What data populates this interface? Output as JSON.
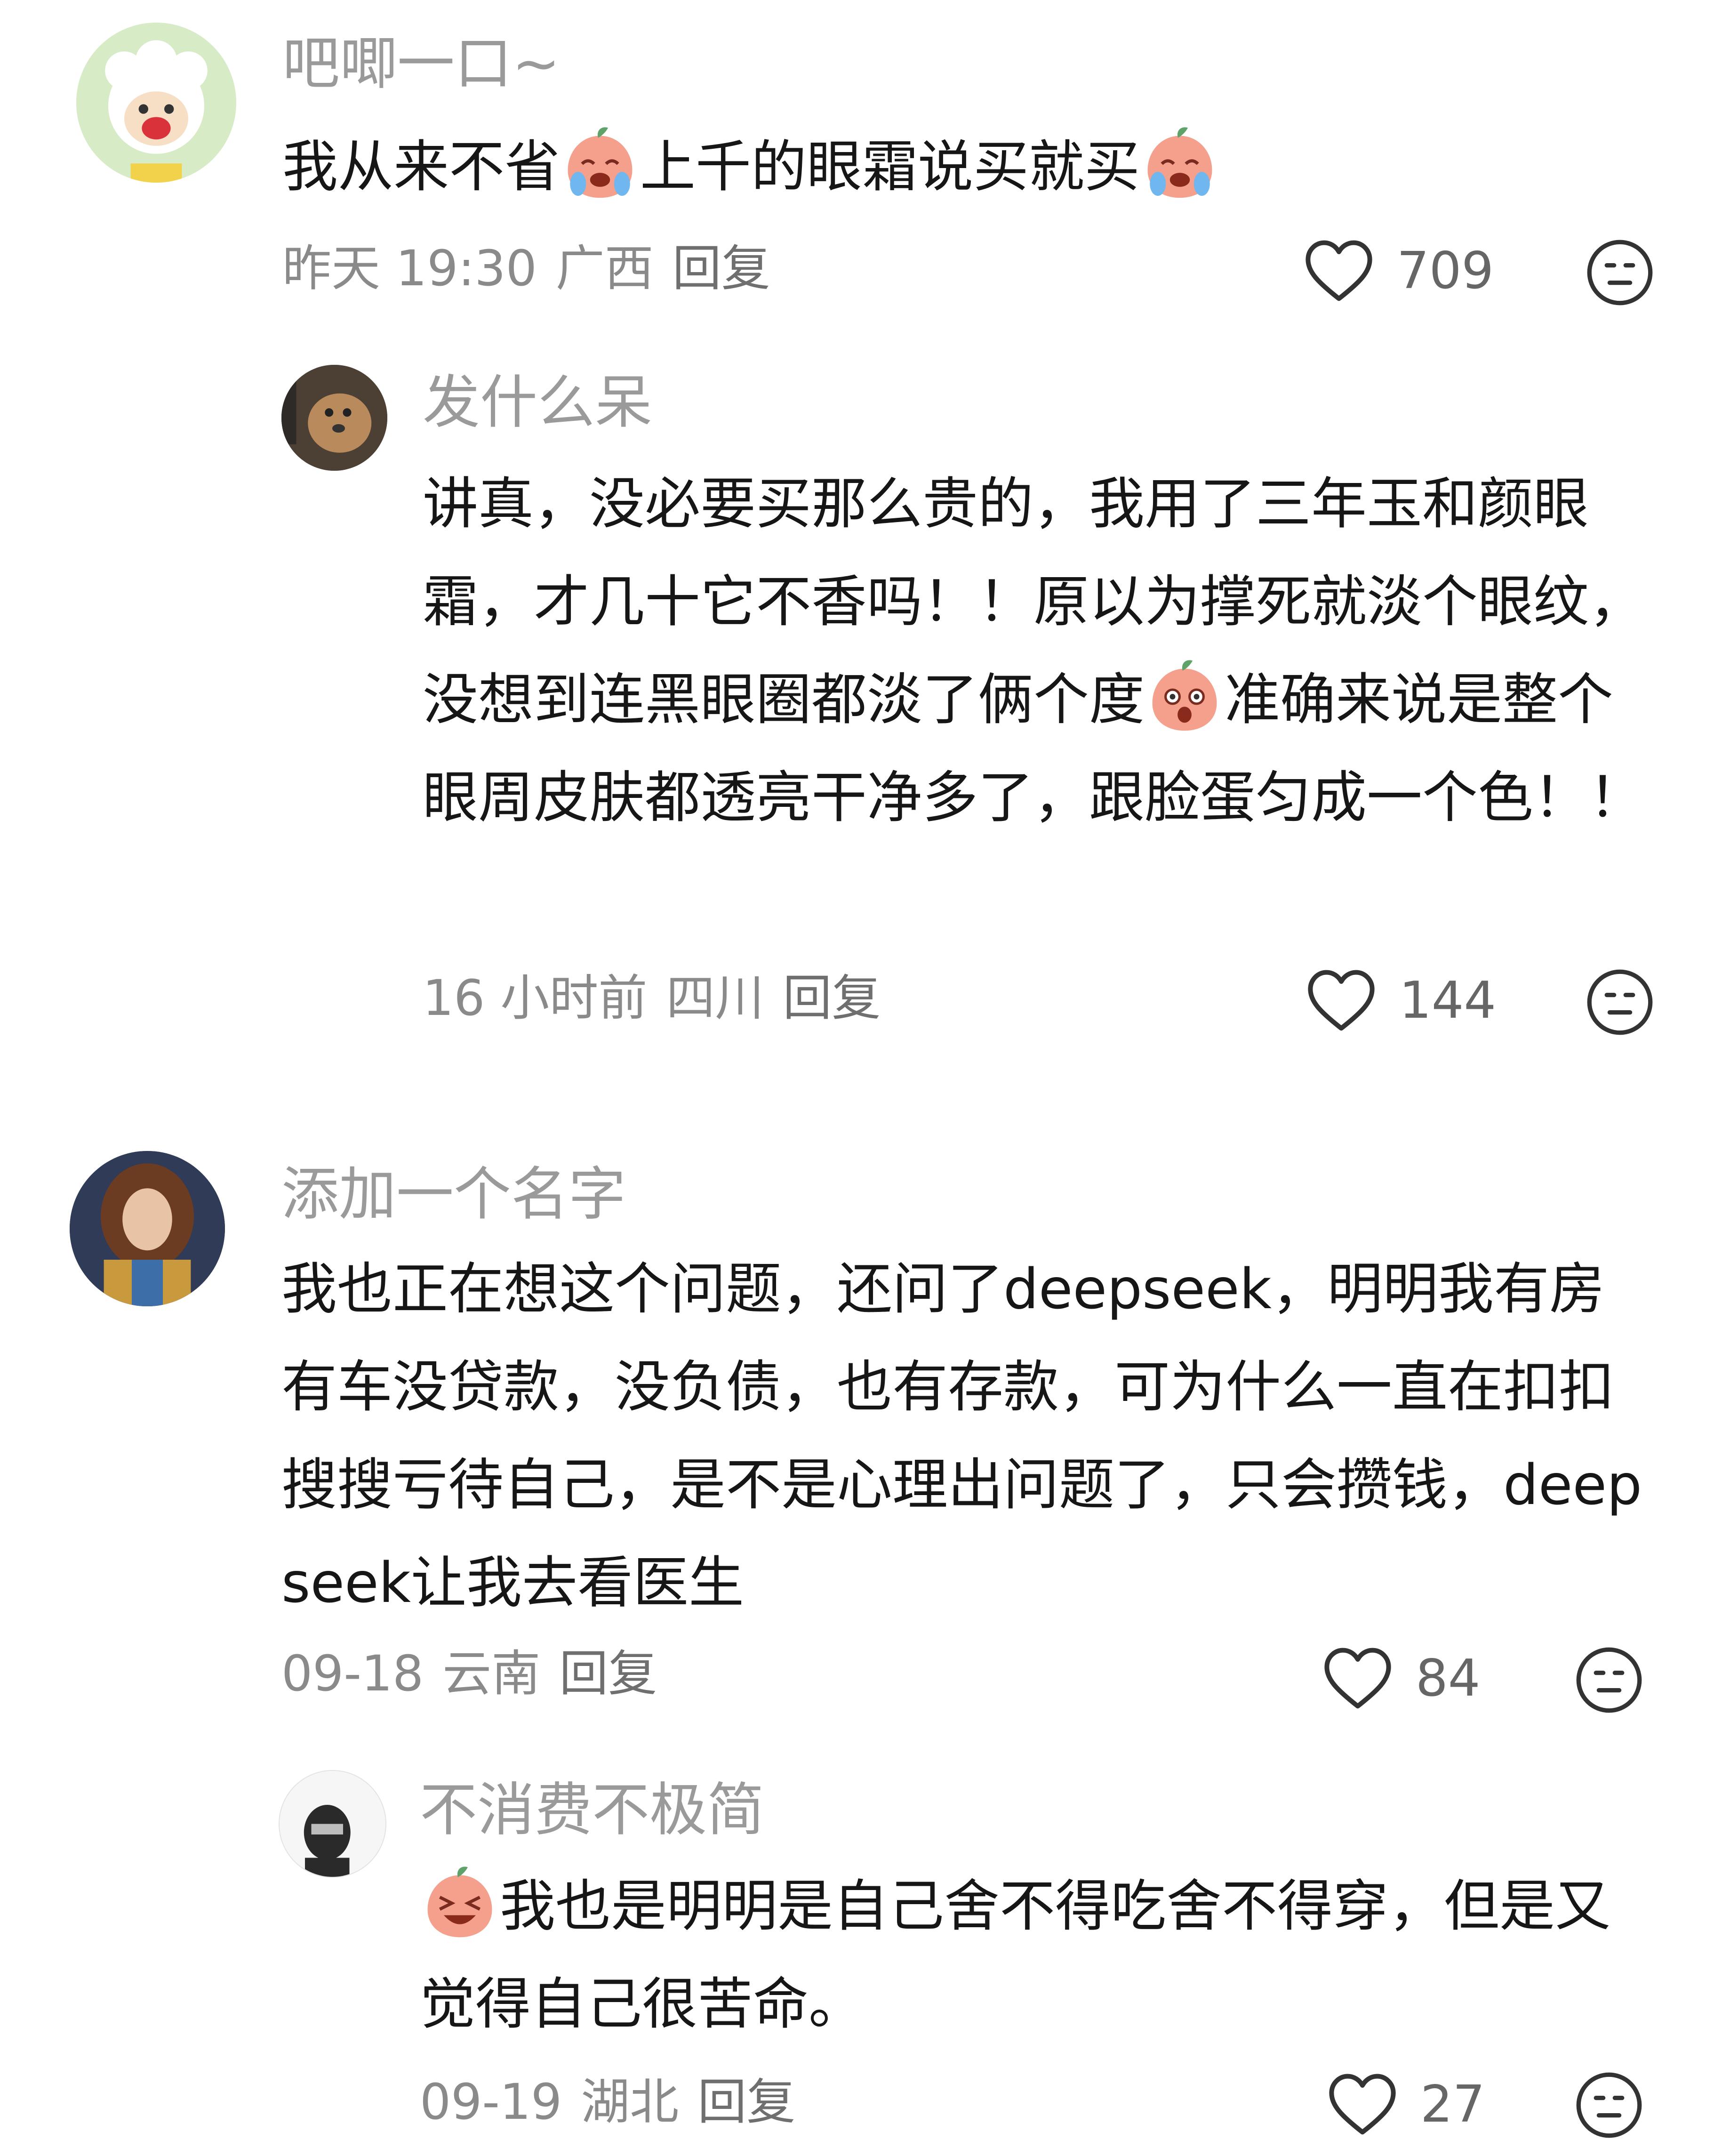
{
  "comments": [
    {
      "username": "吧唧一口~",
      "text_parts": [
        "我从来不省",
        "上千的眼霜说买就买",
        ""
      ],
      "emoji": [
        "crying-peach-emoji",
        "crying-peach-emoji"
      ],
      "time": "昨天 19:30",
      "region": "广西",
      "reply_label": "回复",
      "likes": "709",
      "replies": [
        {
          "username": "发什么呆",
          "text_parts": [
            "讲真，没必要买那么贵的，我用了三年玉和颜眼霜，才几十它不香吗！！原以为撑死就淡个眼纹，没想到连黑眼圈都淡了俩个度",
            "准确来说是整个眼周皮肤都透亮干净多了，跟脸蛋匀成一个色！！"
          ],
          "emoji": [
            "surprised-peach-emoji"
          ],
          "time": "16 小时前",
          "region": "四川",
          "reply_label": "回复",
          "likes": "144"
        }
      ]
    },
    {
      "username": "添加一个名字",
      "text": "我也正在想这个问题，还问了deepseek，明明我有房有车没贷款，没负债，也有存款，可为什么一直在扣扣搜搜亏待自己，是不是心理出问题了，只会攒钱，deepseek让我去看医生",
      "time": "09-18",
      "region": "云南",
      "reply_label": "回复",
      "likes": "84",
      "replies": [
        {
          "username": "不消费不极简",
          "text_parts": [
            "",
            "我也是明明是自己舍不得吃舍不得穿，但是又觉得自己很苦命。"
          ],
          "emoji": [
            "laughing-peach-emoji"
          ],
          "time": "09-19",
          "region": "湖北",
          "reply_label": "回复",
          "likes": "27"
        }
      ]
    }
  ],
  "colors": {
    "username": "#9a9a9a",
    "text": "#161616",
    "meta": "#8a8a8a",
    "icon": "#333333",
    "peach": "#f08a74"
  }
}
